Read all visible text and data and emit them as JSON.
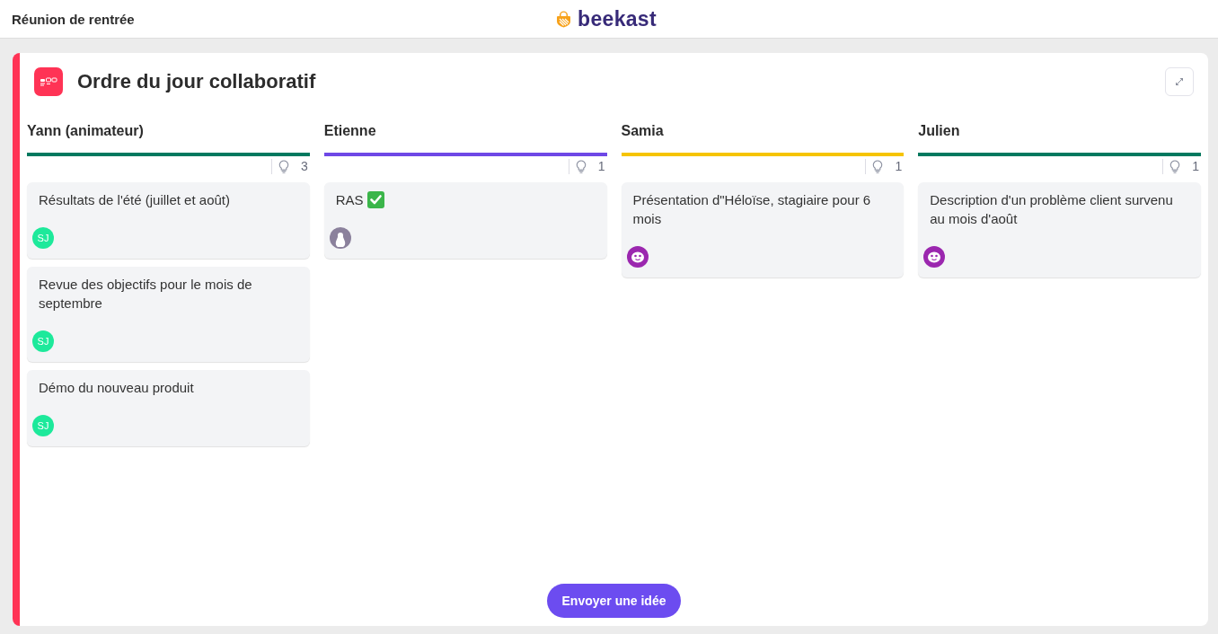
{
  "header": {
    "title": "Réunion de rentrée",
    "logo": "beekast"
  },
  "activity": {
    "title": "Ordre du jour collaboratif"
  },
  "columns": [
    {
      "name": "Yann (animateur)",
      "color": "#00795f",
      "count": "3",
      "cards": [
        {
          "text": "Résultats de l'été (juillet et août)",
          "done": false,
          "avatar": {
            "kind": "initials",
            "initials": "SJ",
            "color": "#1de99b"
          }
        },
        {
          "text": "Revue des objectifs pour le mois de septembre",
          "done": false,
          "avatar": {
            "kind": "initials",
            "initials": "SJ",
            "color": "#1de99b"
          }
        },
        {
          "text": "Démo du nouveau produit",
          "done": false,
          "avatar": {
            "kind": "initials",
            "initials": "SJ",
            "color": "#1de99b"
          }
        }
      ]
    },
    {
      "name": "Etienne",
      "color": "#6e48e6",
      "count": "1",
      "cards": [
        {
          "text": "RAS",
          "done": true,
          "avatar": {
            "kind": "silhouette",
            "color": "#8b819c"
          }
        }
      ]
    },
    {
      "name": "Samia",
      "color": "#f6c400",
      "count": "1",
      "cards": [
        {
          "text": "Présentation d\"Héloïse, stagiaire pour 6 mois",
          "done": false,
          "avatar": {
            "kind": "cartoon",
            "color": "#9b27af"
          }
        }
      ]
    },
    {
      "name": "Julien",
      "color": "#00795f",
      "count": "1",
      "cards": [
        {
          "text": "Description d'un problème client survenu au mois d'août",
          "done": false,
          "avatar": {
            "kind": "cartoon",
            "color": "#9b27af"
          }
        }
      ]
    }
  ],
  "submit_button": "Envoyer une idée"
}
